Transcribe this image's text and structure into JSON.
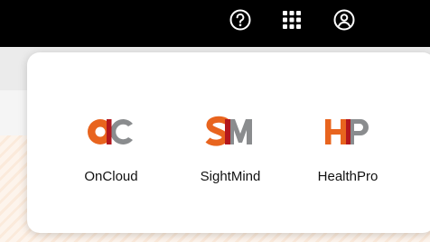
{
  "topbar": {
    "icons": [
      {
        "name": "help-icon"
      },
      {
        "name": "apps-grid-icon"
      },
      {
        "name": "user-account-icon"
      }
    ]
  },
  "apps": [
    {
      "label": "OnCloud",
      "logo_text": "OC"
    },
    {
      "label": "SightMind",
      "logo_text": "SM"
    },
    {
      "label": "HealthPro",
      "logo_text": "HP"
    }
  ],
  "colors": {
    "topbar_bg": "#000000",
    "brand_orange": "#e8641e",
    "brand_gray": "#8a8c8e",
    "brand_red": "#b3171d"
  }
}
